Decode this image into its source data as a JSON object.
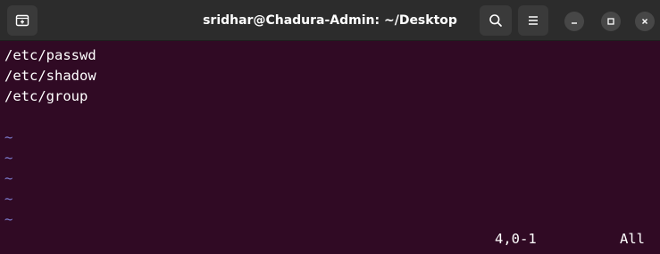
{
  "window": {
    "title": "sridhar@Chadura-Admin: ~/Desktop"
  },
  "titlebar": {
    "new_tab_icon": "new-tab-icon",
    "search_icon": "search-icon",
    "menu_icon": "hamburger-menu-icon",
    "minimize_icon": "minimize-icon",
    "maximize_icon": "maximize-icon",
    "close_icon": "close-icon"
  },
  "editor": {
    "lines": [
      "/etc/passwd",
      "/etc/shadow",
      "/etc/group"
    ],
    "empty_line_marker": "~",
    "status": {
      "cursor_position": "4,0-1",
      "scroll": "All"
    }
  },
  "colors": {
    "terminal_background": "#300a24",
    "titlebar_background": "#2c2c2c",
    "text": "#ffffff",
    "tilde": "#7d7dcf"
  }
}
